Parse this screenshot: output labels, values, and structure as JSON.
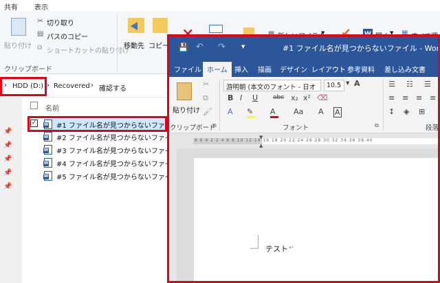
{
  "explorer": {
    "tabs": [
      "共有",
      "表示"
    ],
    "clipboard": {
      "paste": "貼り付け",
      "cut": "切り取り",
      "copy_path": "パスのコピー",
      "paste_shortcut": "ショートカットの貼り付け",
      "group": "クリップボード"
    },
    "organize": {
      "move_to": "移動先",
      "copy_to": "コピー"
    },
    "new": {
      "new_item": "新しいアイテム"
    },
    "open": {
      "open": "開く"
    },
    "select": {
      "select_all": "すべて選"
    },
    "address": {
      "drive": "HDD (D:)",
      "folder1": "Recovered",
      "folder2": "確認する"
    },
    "list_header": "名前",
    "files": [
      "#1 ファイル名が見つからないファイル",
      "#2 ファイル名が見つからないファイル",
      "#3 ファイル名が見つからないファイル",
      "#4 ファイル名が見つからないファイル",
      "#5 ファイル名が見つからないファイル"
    ]
  },
  "word": {
    "title": "#1 ファイル名が見つからないファイル  -  Word",
    "tabs": [
      "ファイル",
      "ホーム",
      "挿入",
      "描画",
      "デザイン",
      "レイアウト",
      "参考資料",
      "差し込み文書"
    ],
    "active_tab": "ホーム",
    "ribbon": {
      "paste": "貼り付け",
      "clipboard_group": "クリップボード",
      "font_name": "游明朝 (本文のフォント - 日オ",
      "font_size": "10.5",
      "font_group": "フォント",
      "paragraph_group": "段落"
    },
    "ruler_numbers": "8 6 4 2  2 4 6 8 10 12 14 16 18 20 22 24 26 28 30 32 34 36 38 40",
    "document_text": "テスト",
    "paragraph_mark": "↵"
  },
  "colors": {
    "word_blue": "#2b579a",
    "highlight_red": "#e60012",
    "folder_yellow": "#f3c95b"
  }
}
